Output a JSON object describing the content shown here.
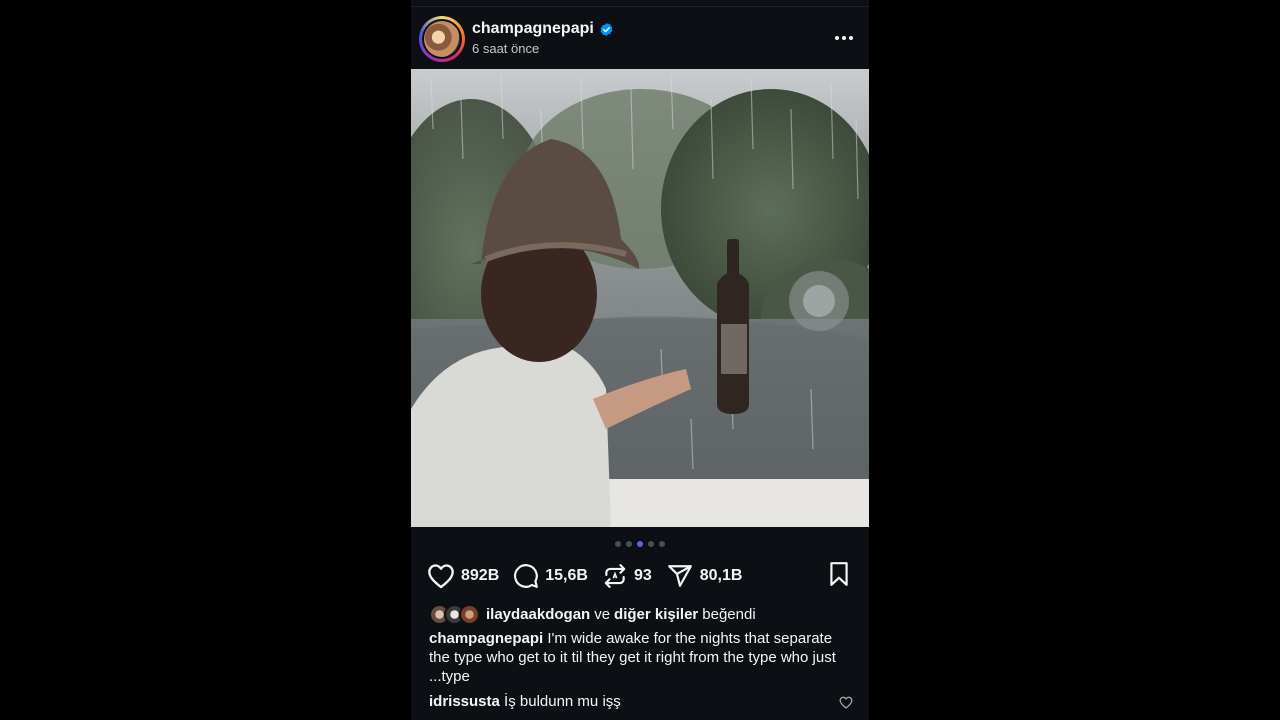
{
  "post": {
    "username": "champagnepapi",
    "time_ago": "6 saat önce",
    "media_alt": "Man in bucket hat holding bottle in front of rain",
    "carousel": {
      "count": 5,
      "active_index": 2
    }
  },
  "actions": {
    "likes": "892B",
    "comments": "15,6B",
    "reposts": "93",
    "shares": "80,1B"
  },
  "liked_by": {
    "user": "ilaydaakdogan",
    "connector": "ve",
    "others": "diğer kişiler",
    "suffix": "beğendi"
  },
  "caption": {
    "username": "champagnepapi",
    "text": "I'm wide awake for the nights that separate the type who get to it til they get it right from the type who just ...type"
  },
  "comment": {
    "username": "idrissusta",
    "text": "İş buldunn mu işş"
  },
  "colors": {
    "background": "#0c1014",
    "verified": "#0095f6",
    "carousel_active": "#4e6bf5"
  }
}
